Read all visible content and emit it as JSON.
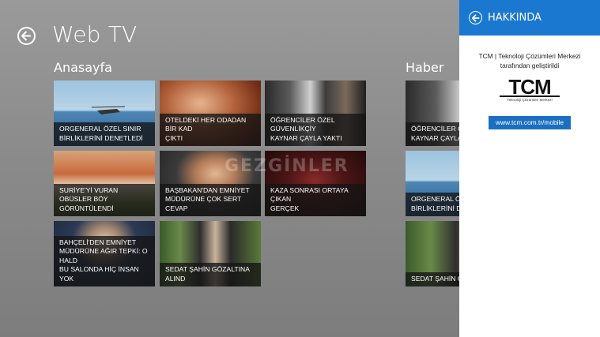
{
  "app": {
    "title": "Web TV"
  },
  "groups": [
    {
      "title": "Anasayfa"
    },
    {
      "title": "Haber"
    }
  ],
  "tiles_home": [
    {
      "caption": "ORGENERAL ÖZEL SINIR\nBİRLİKLERİNİ DENETLEDİ"
    },
    {
      "caption": "OTELDEKİ HER ODADAN BİR KAD\nÇIKTI"
    },
    {
      "caption": "ÖĞRENCİLER ÖZEL GÜVENLİKÇİY\nKAYNAR ÇAYLA YAKTI"
    },
    {
      "caption": "SURİYE'Yİ VURAN OBÜSLER BÖY\nGÖRÜNTÜLENDİ"
    },
    {
      "caption": "BAŞBAKAN'DAN EMNİYET\nMÜDÜRÜNE ÇOK SERT CEVAP"
    },
    {
      "caption": "KAZA SONRASI ORTAYA ÇIKAN\nGERÇEK"
    },
    {
      "caption": "BAHÇELİ'DEN EMNİYET\nMÜDÜRÜNE AĞIR TEPKİ: O HALD\nBU SALONDA HİÇ İNSAN YOK"
    },
    {
      "caption": "SEDAT ŞAHİN GÖZALTINA ALIND"
    }
  ],
  "tiles_news": [
    {
      "caption": "ÖĞRENCİLER ÖZ\nKAYNAR ÇAYLA"
    },
    {
      "caption": "ORGENERAL ÖZ\nBİRLİKLERİNİ DE"
    },
    {
      "caption": "SEDAT ŞAHİN GÖ"
    }
  ],
  "watermark": "GEZGİNLER",
  "flyout": {
    "title": "HAKKINDA",
    "description_line1": "TCM | Teknoloji Çözümleri Merkezi",
    "description_line2": "tarafından geliştirildi",
    "logo_text": "TCM",
    "logo_subtext": "Teknoloji Çözümleri Merkezi",
    "link_label": "www.tcm.com.tr/mobile"
  },
  "colors": {
    "accent": "#1b78d0",
    "link_button": "#1b6fc2",
    "caption_bg": "#141414"
  }
}
